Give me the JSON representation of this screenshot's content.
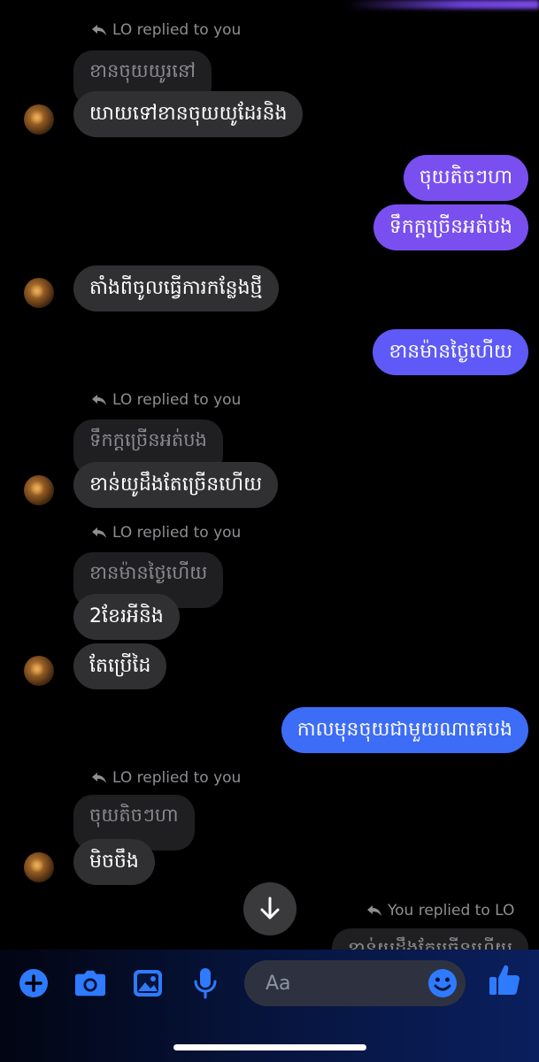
{
  "colors": {
    "accent": "#2f7bff",
    "bubble_incoming": "#303033",
    "bubble_out_purple": "#7a4ff0",
    "bubble_out_indigo": "#5e59f7",
    "bubble_out_blue": "#3d6cf6"
  },
  "messages": {
    "reply_1": "LO replied to you",
    "quote_1": "ខានចុយយូរនៅ",
    "msg_1": "យាយទៅខានចុយយូដែរនិង",
    "out_1": "ចុយតិចៗហា",
    "out_2": "ទឹកក្ដច្រើនអត់បង",
    "msg_2": "តាំងពីចូលធ្វើការកន្លែងថ្មី",
    "out_3": "ខានម៉ានថ្ងៃហើយ",
    "reply_2": "LO replied to you",
    "quote_2": "ទឹកក្ដច្រើនអត់បង",
    "msg_3": "ខាន់យូដឹងតែច្រើនហើយ",
    "reply_3": "LO replied to you",
    "quote_3": "ខានម៉ានថ្ងៃហើយ",
    "msg_4": "2ខែរអីនិង",
    "msg_5": "តែប្រើដៃ",
    "out_4": "កាលមុនចុយជាមួយណាគេបង",
    "reply_4": "LO replied to you",
    "quote_4": "ចុយតិចៗហា",
    "msg_6": "មិចចឹង",
    "reply_5": "You replied to LO",
    "quote_5": "ខាន់យូដឹងតែច្រើនហើយ"
  },
  "composer": {
    "placeholder": "Aa",
    "icons": [
      "plus-icon",
      "camera-icon",
      "gallery-icon",
      "microphone-icon",
      "emoji-icon",
      "thumbs-up-icon"
    ]
  }
}
